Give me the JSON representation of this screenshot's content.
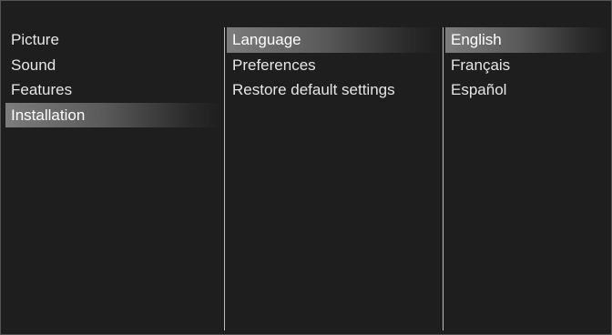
{
  "menu": {
    "main_items": [
      {
        "label": "Picture",
        "selected": false
      },
      {
        "label": "Sound",
        "selected": false
      },
      {
        "label": "Features",
        "selected": false
      },
      {
        "label": "Installation",
        "selected": true
      }
    ],
    "sub_items": [
      {
        "label": "Language",
        "selected": true
      },
      {
        "label": "Preferences",
        "selected": false
      },
      {
        "label": "Restore default settings",
        "selected": false
      }
    ],
    "options": [
      {
        "label": "English",
        "selected": true
      },
      {
        "label": "Français",
        "selected": false
      },
      {
        "label": "Español",
        "selected": false
      }
    ]
  },
  "colors": {
    "background": "#1e1e1e",
    "text": "#e6e6e6",
    "highlight": "#7c7c7c",
    "divider": "#bdbdbd"
  }
}
